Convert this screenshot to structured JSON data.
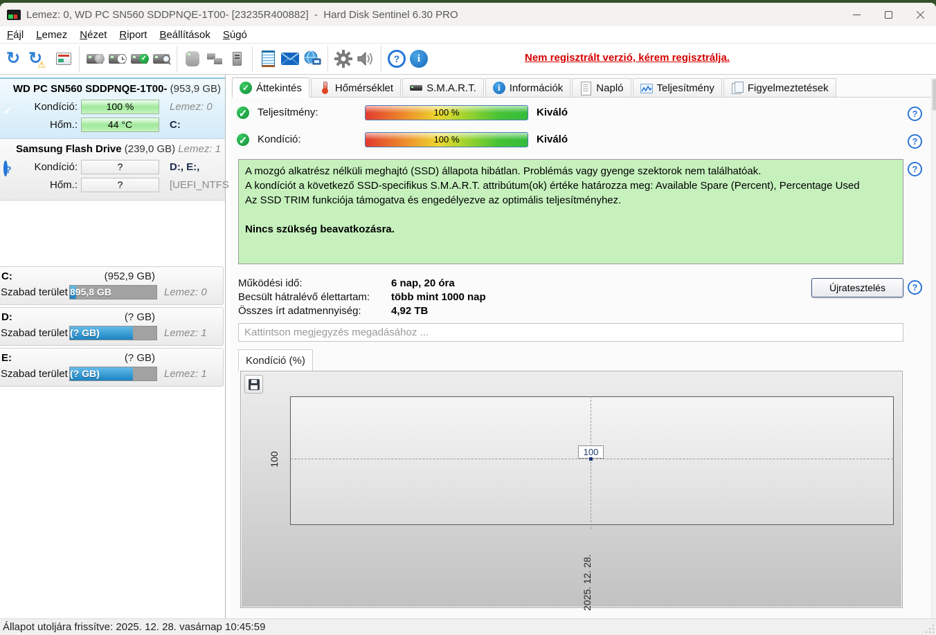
{
  "window": {
    "title": "Lemez: 0, WD PC SN560 SDDPNQE-1T00- [23235R400882]  -  Hard Disk Sentinel 6.30 PRO"
  },
  "menu": {
    "items": [
      {
        "accel": "F",
        "rest": "ájl"
      },
      {
        "accel": "L",
        "rest": "emez"
      },
      {
        "accel": "N",
        "rest": "ézet"
      },
      {
        "accel": "R",
        "rest": "iport"
      },
      {
        "accel": "B",
        "rest": "eállítások"
      },
      {
        "accel": "S",
        "rest": "úgó"
      }
    ]
  },
  "toolbar": {
    "register_notice": "Nem regisztrált verzió, kérem regisztrálja.",
    "icons": [
      "refresh",
      "refresh-warning",
      "disk-properties",
      "disk-surface-test",
      "disk-schedule",
      "disk-status-check",
      "disk-search",
      "hdd-inactive",
      "hardware-pair",
      "device-tower",
      "report-notepad",
      "email-envelope",
      "network-globe",
      "settings-gear",
      "sound-speaker",
      "help-circle",
      "info-circle"
    ]
  },
  "sidebar": {
    "devices": [
      {
        "name": "WD PC SN560 SDDPNQE-1T00-",
        "size": "(953,9 GB)",
        "rows": [
          {
            "label": "Kondíció:",
            "value": "100 %",
            "right": "Lemez: 0"
          },
          {
            "label": "Hőm.:",
            "value": "44 °C",
            "right": "C:"
          }
        ]
      },
      {
        "name": "Samsung Flash Drive",
        "size": "(239,0 GB)",
        "disk": "Lemez: 1",
        "rows": [
          {
            "label": "Kondíció:",
            "value": "?",
            "right": "D:, E:,"
          },
          {
            "label": "Hőm.:",
            "value": "?",
            "right": "[UEFI_NTFS"
          }
        ]
      }
    ],
    "partitions": [
      {
        "letter": "C:",
        "size": "(952,9 GB)",
        "free_label": "Szabad terület",
        "free_value": "895,8 GB",
        "disk": "Lemez: 0",
        "fill": "7%"
      },
      {
        "letter": "D:",
        "size": "(? GB)",
        "free_label": "Szabad terület",
        "free_value": "(? GB)",
        "disk": "Lemez: 1",
        "fill": "73%"
      },
      {
        "letter": "E:",
        "size": "(? GB)",
        "free_label": "Szabad terület",
        "free_value": "(? GB)",
        "disk": "Lemez: 1",
        "fill": "73%"
      }
    ]
  },
  "tabs": [
    {
      "label": "Áttekintés",
      "active": true
    },
    {
      "label": "Hőmérséklet",
      "active": false
    },
    {
      "label": "S.M.A.R.T.",
      "active": false
    },
    {
      "label": "Információk",
      "active": false
    },
    {
      "label": "Napló",
      "active": false
    },
    {
      "label": "Teljesítmény",
      "active": false
    },
    {
      "label": "Figyelmeztetések",
      "active": false
    }
  ],
  "overview": {
    "gauges": [
      {
        "label": "Teljesítmény:",
        "value": "100 %",
        "rating": "Kiváló"
      },
      {
        "label": "Kondíció:",
        "value": "100 %",
        "rating": "Kiváló"
      }
    ],
    "health": {
      "lines": [
        "A mozgó alkatrész nélküli meghajtó (SSD) állapota hibátlan. Problémás vagy gyenge szektorok nem találhatóak.",
        "A kondíciót a következő SSD-specifikus S.M.A.R.T. attribútum(ok) értéke határozza meg:  Available Spare (Percent), Percentage Used",
        "Az SSD TRIM funkciója támogatva és engedélyezve az optimális teljesítményhez."
      ],
      "action": "Nincs szükség beavatkozásra."
    },
    "stats": [
      {
        "label": "Működési idő:",
        "value": "6 nap, 20 óra"
      },
      {
        "label": "Becsült hátralévő élettartam:",
        "value": "több mint 1000 nap"
      },
      {
        "label": "Összes írt adatmennyiség:",
        "value": "4,92 TB"
      }
    ],
    "retest_label": "Újratesztelés",
    "comment_placeholder": "Kattintson megjegyzés megadásához ..."
  },
  "chart": {
    "tab_label": "Kondíció  (%)",
    "y_tick": "100",
    "point_label": "100",
    "x_label": "2025. 12. 28."
  },
  "chart_data": {
    "type": "line",
    "title": "Kondíció (%)",
    "x": [
      "2025. 12. 28."
    ],
    "series": [
      {
        "name": "Kondíció",
        "values": [
          100
        ]
      }
    ],
    "y_ticks": [
      100
    ],
    "annotations": [
      {
        "x": "2025. 12. 28.",
        "y": 100,
        "label": "100"
      }
    ],
    "grid": "dashed",
    "legend": "none"
  },
  "statusbar": {
    "text": "Állapot utoljára frissítve: 2025. 12. 28. vasárnap 10:45:59"
  },
  "colors": {
    "accent_blue": "#1e8bd2",
    "status_green": "#179e3a",
    "notice_red": "#d60000",
    "health_box_green": "#c6f1bd"
  }
}
